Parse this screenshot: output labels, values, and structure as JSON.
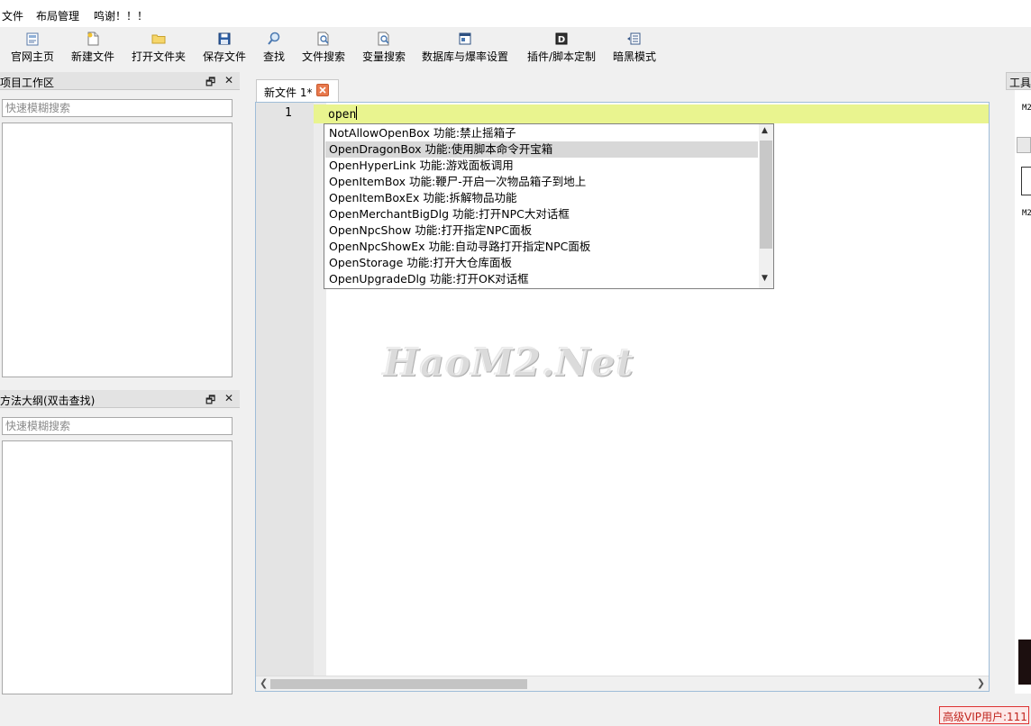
{
  "menu": [
    "文件",
    "布局管理",
    "鸣谢！！！"
  ],
  "toolbar": [
    {
      "label": "官网主页",
      "icon": "home-page-icon"
    },
    {
      "label": "新建文件",
      "icon": "new-file-icon"
    },
    {
      "label": "打开文件夹",
      "icon": "open-folder-icon"
    },
    {
      "label": "保存文件",
      "icon": "save-icon"
    },
    {
      "label": "查找",
      "icon": "search-icon"
    },
    {
      "label": "文件搜索",
      "icon": "file-search-icon"
    },
    {
      "label": "变量搜索",
      "icon": "variable-search-icon"
    },
    {
      "label": "数据库与爆率设置",
      "icon": "database-icon"
    },
    {
      "label": "插件/脚本定制",
      "icon": "plugin-icon"
    },
    {
      "label": "暗黑模式",
      "icon": "dark-mode-icon"
    }
  ],
  "project_panel": {
    "title": "项目工作区",
    "restore": "🗗",
    "close": "✕",
    "search_placeholder": "快速模糊搜索"
  },
  "outline_panel": {
    "title": "方法大纲(双击查找)",
    "restore": "🗗",
    "close": "✕",
    "search_placeholder": "快速模糊搜索"
  },
  "editor": {
    "tab_label": "新文件 1*",
    "line_number": "1",
    "code": "open"
  },
  "autocomplete": [
    {
      "name": "NotAllowOpenBox",
      "desc": " 功能:禁止摇箱子"
    },
    {
      "name": "OpenDragonBox",
      "desc": " 功能:使用脚本命令开宝箱"
    },
    {
      "name": "OpenHyperLink",
      "desc": " 功能:游戏面板调用"
    },
    {
      "name": "OpenItemBox",
      "desc": " 功能:鞭尸-开启一次物品箱子到地上"
    },
    {
      "name": "OpenItemBoxEx",
      "desc": " 功能:拆解物品功能"
    },
    {
      "name": "OpenMerchantBigDlg",
      "desc": " 功能:打开NPC大对话框"
    },
    {
      "name": "OpenNpcShow",
      "desc": " 功能:打开指定NPC面板"
    },
    {
      "name": "OpenNpcShowEx",
      "desc": " 功能:自动寻路打开指定NPC面板"
    },
    {
      "name": "OpenStorage",
      "desc": " 功能:打开大仓库面板"
    },
    {
      "name": "OpenUpgradeDlg",
      "desc": " 功能:打开OK对话框"
    }
  ],
  "autocomplete_selected_index": 1,
  "watermark": "HaoM2.Net",
  "right_panel": {
    "title": "工具",
    "text1": "M2",
    "text2": "M2"
  },
  "status": "高级VIP用户:111",
  "colors": {
    "current_line": "#e9f48f",
    "status_border": "#dd3333",
    "tab_close": "#e8794d"
  }
}
